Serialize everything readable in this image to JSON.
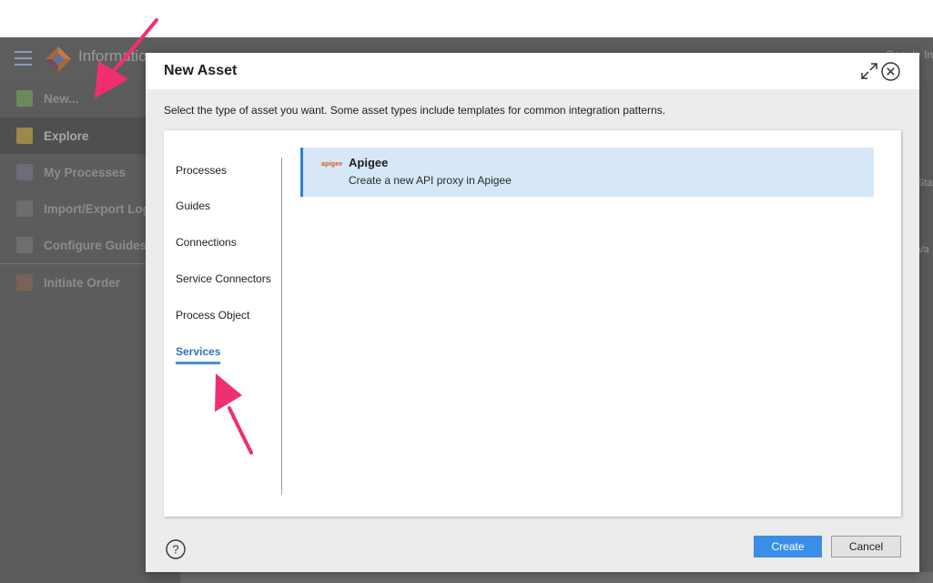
{
  "background_app": {
    "title": "Informatio",
    "top_right_text": "Google In",
    "right_edge_labels": [
      "Sta",
      "Va"
    ],
    "sidebar": {
      "items": [
        {
          "label": "New...",
          "icon": "plus-icon"
        },
        {
          "label": "Explore",
          "icon": "folder-icon"
        },
        {
          "label": "My Processes",
          "icon": "document-icon"
        },
        {
          "label": "Import/Export Logs",
          "icon": "log-icon"
        },
        {
          "label": "Configure Guides",
          "icon": "wrench-icon"
        },
        {
          "label": "Initiate Order",
          "icon": "shapes-icon"
        }
      ]
    }
  },
  "modal": {
    "title": "New Asset",
    "subtitle": "Select the type of asset you want. Some asset types include templates for common integration patterns.",
    "categories": [
      {
        "label": "Processes"
      },
      {
        "label": "Guides"
      },
      {
        "label": "Connections"
      },
      {
        "label": "Service Connectors"
      },
      {
        "label": "Process Object"
      },
      {
        "label": "Services",
        "selected": true
      }
    ],
    "assets": [
      {
        "logo_text": "apigee",
        "name": "Apigee",
        "description": "Create a new API proxy in Apigee",
        "selected": true
      }
    ],
    "buttons": {
      "create": "Create",
      "cancel": "Cancel"
    },
    "help_symbol": "?"
  },
  "colors": {
    "accent": "#3b8ee8",
    "selected_card_bg": "#d6e8f7",
    "annotation_arrow": "#f0306e",
    "overlay_gray": "#5c5c5c"
  }
}
